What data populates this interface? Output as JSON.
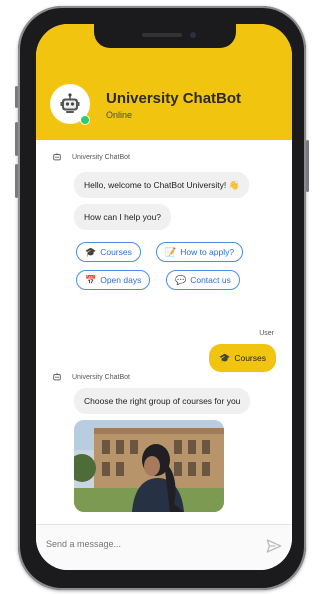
{
  "header": {
    "title": "University ChatBot",
    "status": "Online",
    "avatar_icon": "robot-icon",
    "accent_color": "#f1c40f",
    "online_color": "#2ecc71"
  },
  "messages": {
    "bot_sender": "University ChatBot",
    "welcome": "Hello, welcome to ChatBot University! 👋",
    "help": "How can I help you?",
    "quick_replies": [
      {
        "icon": "graduation-cap-icon",
        "label": "Courses"
      },
      {
        "icon": "notepad-icon",
        "label": "How to apply?"
      },
      {
        "icon": "calendar-icon",
        "label": "Open days"
      },
      {
        "icon": "speech-bubble-icon",
        "label": "Contact us"
      }
    ],
    "user_sender": "User",
    "user_reply": {
      "icon": "graduation-cap-icon",
      "label": "Courses"
    },
    "choose": "Choose the right group of courses for you"
  },
  "composer": {
    "placeholder": "Send a message...",
    "send_icon": "send-icon"
  }
}
